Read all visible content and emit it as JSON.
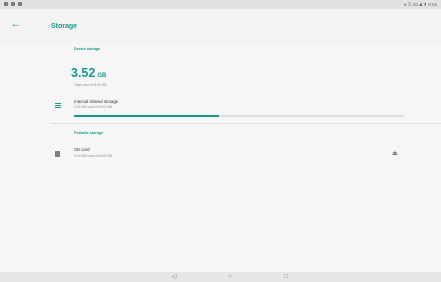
{
  "status_bar": {
    "right_text": "⚹ ⊙ 3G◢ ▮ 9:56"
  },
  "app_bar": {
    "back_icon": "arrow-left-icon",
    "title": "Storage"
  },
  "device_storage": {
    "header": "Device storage",
    "used_value": "3.52",
    "used_unit": "GB",
    "total_caption": "Total used of 8.00 GB",
    "items": [
      {
        "icon": "list-icon",
        "title": "Internal shared storage",
        "subtitle": "3.52 GB used of 8.00 GB",
        "usage_fraction": 0.44
      }
    ]
  },
  "portable_storage": {
    "header": "Portable storage",
    "items": [
      {
        "icon": "sd-card-icon",
        "title": "SD card",
        "subtitle": "3.04 GB used of 8.05 GB",
        "action_icon": "eject-icon"
      }
    ]
  },
  "nav_bar": {
    "back": "◁",
    "home": "○",
    "recents": "□"
  },
  "colors": {
    "accent": "#159a8b",
    "background": "#f6f6f6"
  }
}
